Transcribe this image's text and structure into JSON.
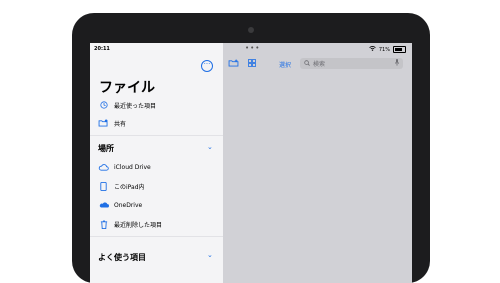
{
  "status": {
    "time": "20:11",
    "battery": "71%"
  },
  "sidebar": {
    "title": "ファイル",
    "top_items": [
      {
        "label": "最近使った項目",
        "icon": "clock-icon"
      },
      {
        "label": "共有",
        "icon": "shared-folder-icon"
      }
    ],
    "locations_header": "場所",
    "locations": [
      {
        "label": "iCloud Drive",
        "icon": "cloud-icon"
      },
      {
        "label": "このiPad内",
        "icon": "ipad-icon"
      },
      {
        "label": "OneDrive",
        "icon": "onedrive-cloud-icon"
      },
      {
        "label": "最近削除した項目",
        "icon": "trash-icon"
      }
    ],
    "favorites_header": "よく使う項目"
  },
  "toolbar": {
    "select_label": "選択",
    "search_placeholder": "検索"
  },
  "colors": {
    "accent": "#1f6fe5",
    "sidebar_bg": "#f4f4f6",
    "content_bg": "#d1d1d6",
    "device_frame": "#1c1c1e"
  }
}
